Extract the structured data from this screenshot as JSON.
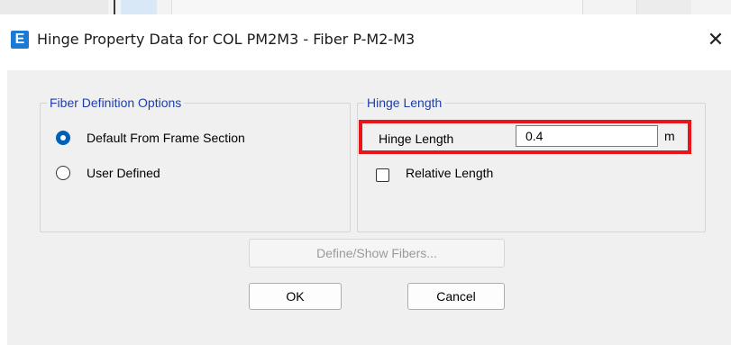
{
  "window": {
    "title": "Hinge Property Data for COL PM2M3 - Fiber P-M2-M3",
    "app_icon_glyph": "E",
    "close_glyph": "✕",
    "accent_color": "#1a7ad4"
  },
  "fiber_definition_options": {
    "legend": "Fiber Definition Options",
    "options": [
      {
        "label": "Default From Frame Section",
        "selected": true
      },
      {
        "label": "User Defined",
        "selected": false
      }
    ]
  },
  "hinge_length": {
    "legend": "Hinge Length",
    "field_label": "Hinge Length",
    "value": "0.4",
    "unit": "m",
    "highlight_color": "#e8141a",
    "relative_length": {
      "label": "Relative Length",
      "checked": false
    }
  },
  "buttons": {
    "define_show_fibers": "Define/Show Fibers...",
    "ok": "OK",
    "cancel": "Cancel"
  }
}
